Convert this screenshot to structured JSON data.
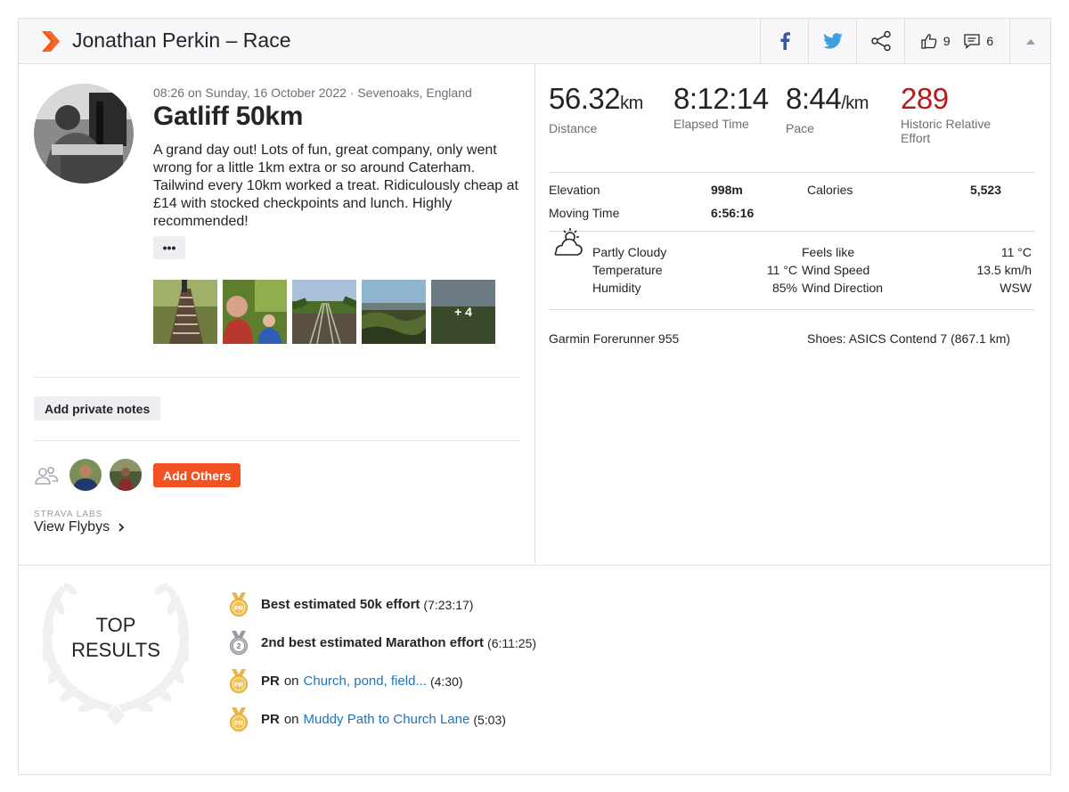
{
  "header": {
    "title": "Jonathan Perkin – Race",
    "kudos_count": "9",
    "comment_count": "6",
    "brand_color": "#fc5200"
  },
  "activity": {
    "meta": "08:26 on Sunday, 16 October 2022 · Sevenoaks, England",
    "name": "Gatliff 50km",
    "description": "A grand day out! Lots of fun, great company, only went wrong for a little 1km extra or so around Caterham. Tailwind every 10km worked a treat. Ridiculously cheap at £14 with stocked checkpoints and lunch. Highly recommended!",
    "more_label": "•••",
    "photos_more_label": "+ 4",
    "private_notes_label": "Add private notes",
    "add_others_label": "Add Others",
    "labs_label": "STRAVA LABS",
    "flybys_label": "View Flybys"
  },
  "stats": {
    "distance": {
      "value": "56.32",
      "unit": "km",
      "label": "Distance"
    },
    "elapsed": {
      "value": "8:12:14",
      "label": "Elapsed Time"
    },
    "pace": {
      "value": "8:44",
      "unit": "/km",
      "label": "Pace"
    },
    "effort": {
      "value": "289",
      "label_1": "Historic Relative",
      "label_2": "Effort",
      "color": "#b8191b"
    }
  },
  "details": {
    "elevation_label": "Elevation",
    "elevation": "998m",
    "calories_label": "Calories",
    "calories": "5,523",
    "moving_label": "Moving Time",
    "moving": "6:56:16"
  },
  "weather": {
    "condition": "Partly Cloudy",
    "temperature_label": "Temperature",
    "temperature": "11 °C",
    "humidity_label": "Humidity",
    "humidity": "85%",
    "feels_like_label": "Feels like",
    "feels_like": "11 °C",
    "wind_speed_label": "Wind Speed",
    "wind_speed": "13.5 km/h",
    "wind_direction_label": "Wind Direction",
    "wind_direction": "WSW"
  },
  "gear": {
    "device": "Garmin Forerunner 955",
    "shoes": "Shoes: ASICS Contend 7 (867.1 km)"
  },
  "top_results": {
    "title_1": "TOP",
    "title_2": "RESULTS",
    "items": [
      {
        "badge": "PR",
        "medal": "gold",
        "text": "Best estimated 50k effort",
        "time": "(7:23:17)"
      },
      {
        "badge": "2",
        "medal": "silver",
        "text": "2nd best estimated Marathon effort",
        "time": "(6:11:25)"
      },
      {
        "badge": "PR",
        "medal": "gold",
        "prefix": "PR",
        "on": "on",
        "segment": "Church, pond, field...",
        "time": "(4:30)"
      },
      {
        "badge": "PR",
        "medal": "gold",
        "prefix": "PR",
        "on": "on",
        "segment": "Muddy Path to Church Lane",
        "time": "(5:03)"
      }
    ]
  }
}
